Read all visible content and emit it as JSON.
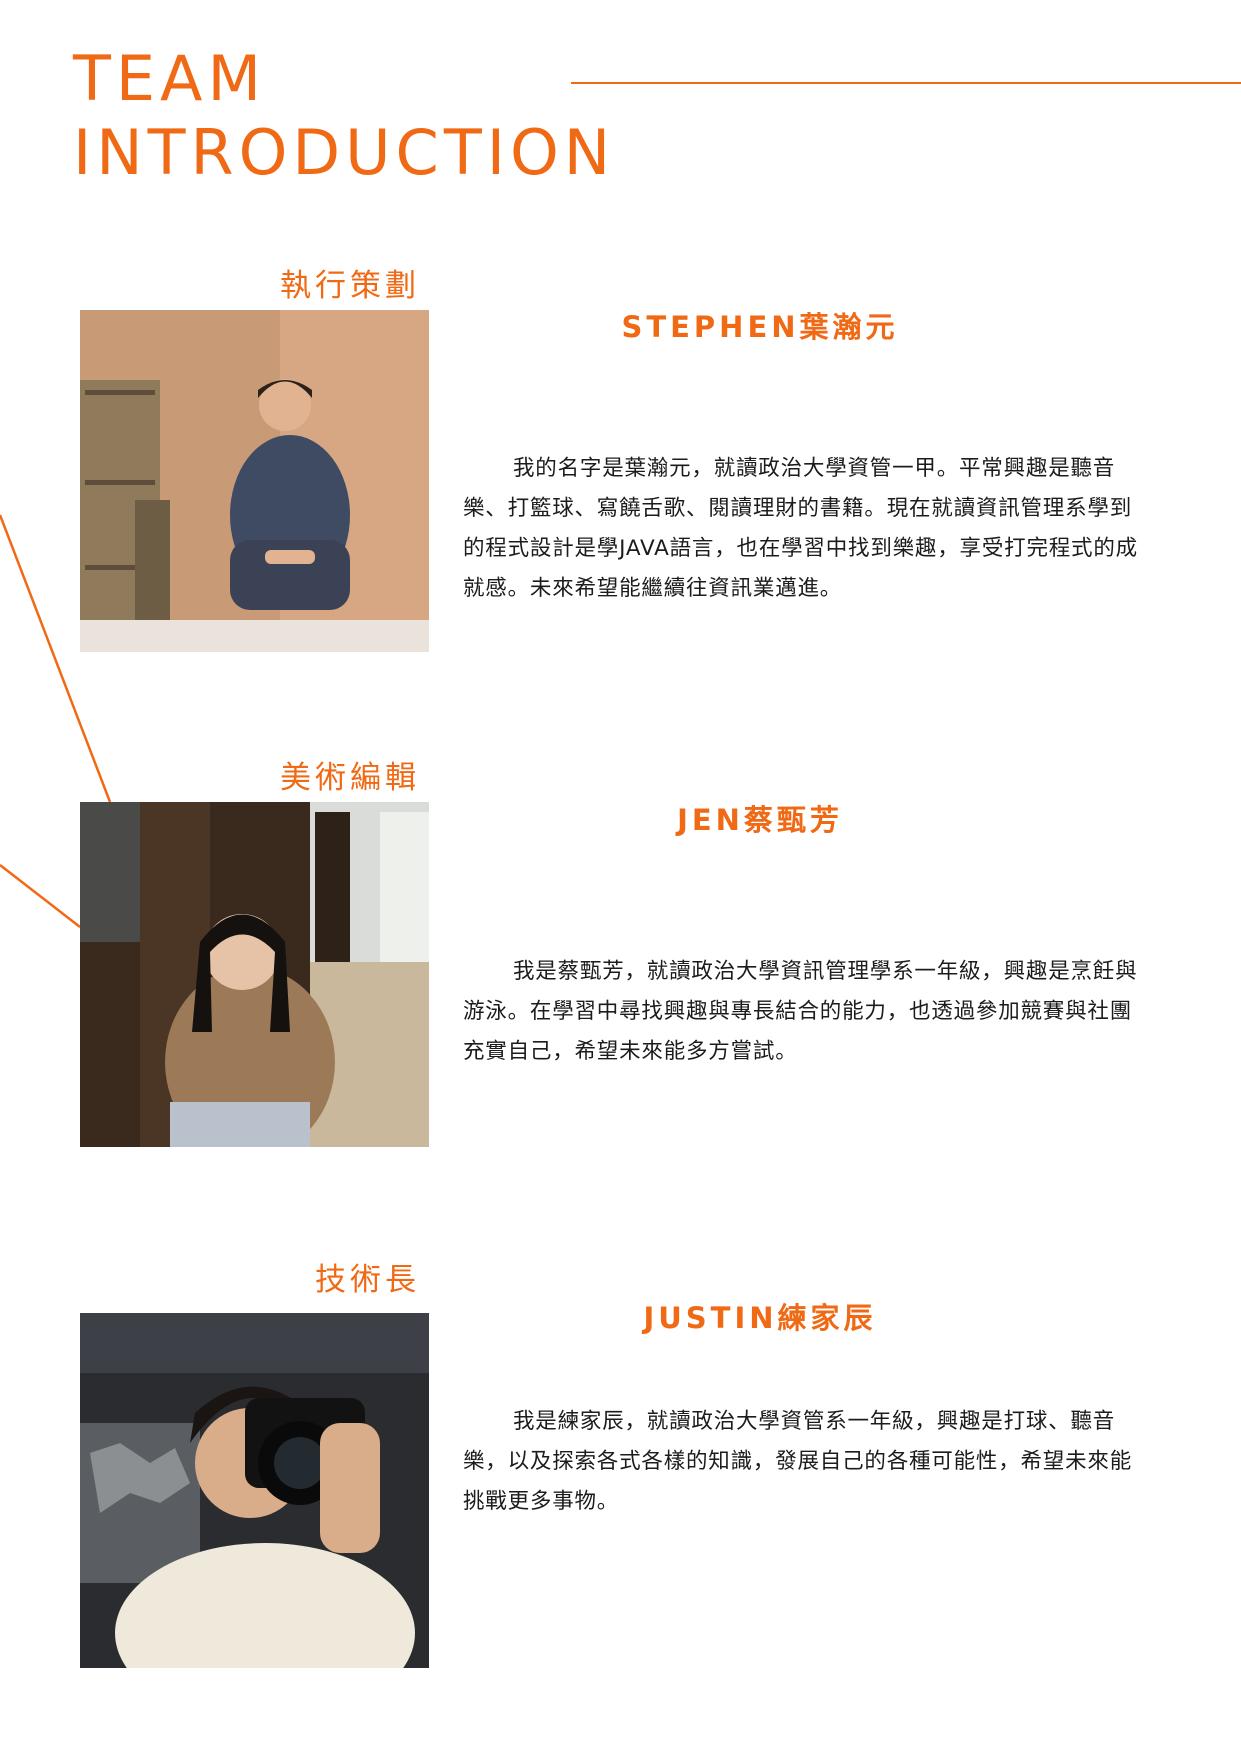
{
  "header": {
    "title_line1": "TEAM",
    "title_line2": "INTRODUCTION"
  },
  "colors": {
    "accent": "#f06a15",
    "text": "#1c1c1c",
    "background": "#ffffff"
  },
  "members": [
    {
      "role": "執行策劃",
      "name": "STEPHEN葉瀚元",
      "bio": "我的名字是葉瀚元，就讀政治大學資管一甲。平常興趣是聽音樂、打籃球、寫饒舌歌、閱讀理財的書籍。現在就讀資訊管理系學到的程式設計是學JAVA語言，也在學習中找到樂趣，享受打完程式的成就感。未來希望能繼續往資訊業邁進。"
    },
    {
      "role": "美術編輯",
      "name": "JEN蔡甄芳",
      "bio": "我是蔡甄芳，就讀政治大學資訊管理學系一年級，興趣是烹飪與游泳。在學習中尋找興趣與專長結合的能力，也透過參加競賽與社團充實自己，希望未來能多方嘗試。"
    },
    {
      "role": "技術長",
      "name": "JUSTIN練家辰",
      "bio": "我是練家辰，就讀政治大學資管系一年級，興趣是打球、聽音樂，以及探索各式各樣的知識，發展自己的各種可能性，希望未來能挑戰更多事物。"
    }
  ]
}
